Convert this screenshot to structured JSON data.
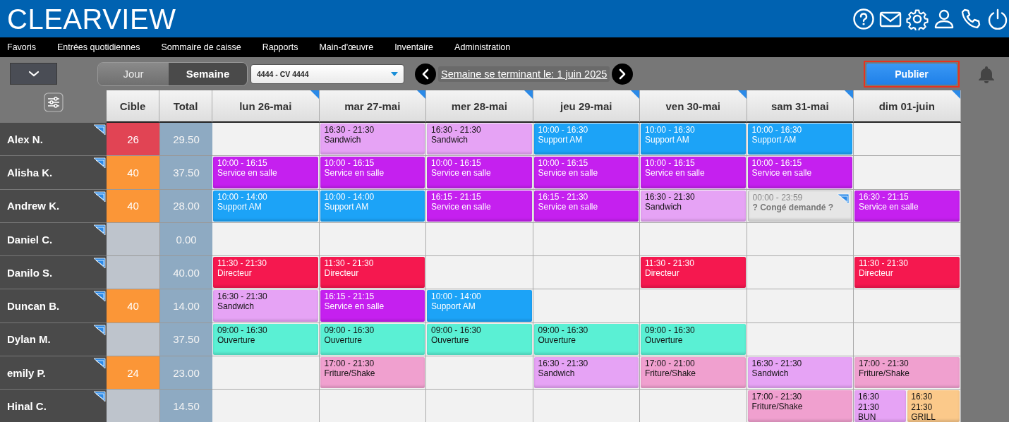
{
  "app": {
    "logo": "CLEARVIEW"
  },
  "menu": [
    "Favoris",
    "Entrées quotidiennes",
    "Sommaire de caisse",
    "Rapports",
    "Main-d'œuvre",
    "Inventaire",
    "Administration"
  ],
  "toolbar": {
    "views": [
      {
        "label": "Jour",
        "selected": false
      },
      {
        "label": "Semaine",
        "selected": true
      }
    ],
    "location_select": {
      "value": "4444 - CV 4444"
    },
    "week_label": "Semaine se terminant le: 1 juin 2025",
    "publish_button": {
      "label": "Publier",
      "highlighted": true
    }
  },
  "schedule": {
    "target_heading": "Cible",
    "total_heading": "Total",
    "days": [
      {
        "label": "lun 26-mai",
        "flagged": true
      },
      {
        "label": "mar 27-mai",
        "flagged": true
      },
      {
        "label": "mer 28-mai",
        "flagged": true
      },
      {
        "label": "jeu 29-mai",
        "flagged": true
      },
      {
        "label": "ven 30-mai",
        "flagged": true
      },
      {
        "label": "sam 31-mai",
        "flagged": true
      },
      {
        "label": "dim 01-juin",
        "flagged": true
      }
    ],
    "rows": [
      {
        "name": "Alex N.",
        "flagged": true,
        "target": {
          "value": "26",
          "color": "#e14454"
        },
        "total": "29.50",
        "cells": [
          {},
          {
            "shifts": [
              {
                "kind": "shift",
                "time": "16:30 - 21:30",
                "role": "Sandwich",
                "color": "#e6a3f5"
              }
            ]
          },
          {
            "shifts": [
              {
                "kind": "shift",
                "time": "16:30 - 21:30",
                "role": "Sandwich",
                "color": "#e6a3f5"
              }
            ]
          },
          {
            "shifts": [
              {
                "kind": "shift",
                "time": "10:00 - 16:30",
                "role": "Support AM",
                "color": "#1ca3f7"
              }
            ]
          },
          {
            "shifts": [
              {
                "kind": "shift",
                "time": "10:00 - 16:30",
                "role": "Support AM",
                "color": "#1ca3f7"
              }
            ]
          },
          {
            "shifts": [
              {
                "kind": "shift",
                "time": "10:00 - 16:30",
                "role": "Support AM",
                "color": "#1ca3f7"
              }
            ]
          },
          {}
        ]
      },
      {
        "name": "Alisha K.",
        "flagged": true,
        "target": {
          "value": "40",
          "color": "#fb9637"
        },
        "total": "37.50",
        "cells": [
          {
            "shifts": [
              {
                "kind": "shift",
                "time": "10:00 - 16:15",
                "role": "Service en salle",
                "color": "#c520ef"
              }
            ]
          },
          {
            "shifts": [
              {
                "kind": "shift",
                "time": "10:00 - 16:15",
                "role": "Service en salle",
                "color": "#c520ef"
              }
            ]
          },
          {
            "shifts": [
              {
                "kind": "shift",
                "time": "10:00 - 16:15",
                "role": "Service en salle",
                "color": "#c520ef"
              }
            ]
          },
          {
            "shifts": [
              {
                "kind": "shift",
                "time": "10:00 - 16:15",
                "role": "Service en salle",
                "color": "#c520ef"
              }
            ]
          },
          {
            "shifts": [
              {
                "kind": "shift",
                "time": "10:00 - 16:15",
                "role": "Service en salle",
                "color": "#c520ef"
              }
            ]
          },
          {
            "shifts": [
              {
                "kind": "shift",
                "time": "10:00 - 16:15",
                "role": "Service en salle",
                "color": "#c520ef"
              }
            ]
          },
          {}
        ]
      },
      {
        "name": "Andrew K.",
        "flagged": true,
        "target": {
          "value": "40",
          "color": "#fb9637"
        },
        "total": "28.00",
        "cells": [
          {
            "shifts": [
              {
                "kind": "shift",
                "time": "10:00 - 14:00",
                "role": "Support AM",
                "color": "#1ca3f7"
              }
            ]
          },
          {
            "shifts": [
              {
                "kind": "shift",
                "time": "10:00 - 14:00",
                "role": "Support AM",
                "color": "#1ca3f7"
              }
            ]
          },
          {
            "shifts": [
              {
                "kind": "shift",
                "time": "16:15 - 21:15",
                "role": "Service en salle",
                "color": "#c520ef"
              }
            ]
          },
          {
            "shifts": [
              {
                "kind": "shift",
                "time": "16:15 - 21:30",
                "role": "Service en salle",
                "color": "#c520ef"
              }
            ]
          },
          {
            "shifts": [
              {
                "kind": "shift",
                "time": "16:30 - 21:30",
                "role": "Sandwich",
                "color": "#e6a3f5"
              }
            ]
          },
          {
            "shifts": [
              {
                "kind": "leave",
                "time": "00:00 - 23:59",
                "role": "? Congé demandé ?",
                "color": "#e6e6e6",
                "flagged": true
              }
            ]
          },
          {
            "shifts": [
              {
                "kind": "shift",
                "time": "16:30 - 21:15",
                "role": "Service en salle",
                "color": "#c520ef"
              }
            ]
          }
        ]
      },
      {
        "name": "Daniel C.",
        "flagged": true,
        "total": "0.00",
        "cells": [
          {},
          {},
          {},
          {},
          {},
          {},
          {}
        ]
      },
      {
        "name": "Danilo S.",
        "flagged": true,
        "total": "40.00",
        "cells": [
          {
            "shifts": [
              {
                "kind": "shift",
                "time": "11:30 - 21:30",
                "role": "Directeur",
                "color": "#f5184f"
              }
            ]
          },
          {
            "shifts": [
              {
                "kind": "shift",
                "time": "11:30 - 21:30",
                "role": "Directeur",
                "color": "#f5184f"
              }
            ]
          },
          {},
          {},
          {
            "shifts": [
              {
                "kind": "shift",
                "time": "11:30 - 21:30",
                "role": "Directeur",
                "color": "#f5184f"
              }
            ]
          },
          {},
          {
            "shifts": [
              {
                "kind": "shift",
                "time": "11:30 - 21:30",
                "role": "Directeur",
                "color": "#f5184f"
              }
            ]
          }
        ]
      },
      {
        "name": "Duncan B.",
        "flagged": true,
        "target": {
          "value": "40",
          "color": "#fb9637"
        },
        "total": "14.00",
        "cells": [
          {
            "shifts": [
              {
                "kind": "shift",
                "time": "16:30 - 21:30",
                "role": "Sandwich",
                "color": "#e6a3f5"
              }
            ]
          },
          {
            "shifts": [
              {
                "kind": "shift",
                "time": "16:15 - 21:15",
                "role": "Service en salle",
                "color": "#c520ef"
              }
            ]
          },
          {
            "shifts": [
              {
                "kind": "shift",
                "time": "10:00 - 14:00",
                "role": "Support AM",
                "color": "#1ca3f7"
              }
            ]
          },
          {},
          {},
          {},
          {}
        ]
      },
      {
        "name": "Dylan M.",
        "flagged": true,
        "total": "37.50",
        "cells": [
          {
            "shifts": [
              {
                "kind": "shift",
                "time": "09:00 - 16:30",
                "role": "Ouverture",
                "color": "#5af0d4"
              }
            ]
          },
          {
            "shifts": [
              {
                "kind": "shift",
                "time": "09:00 - 16:30",
                "role": "Ouverture",
                "color": "#5af0d4"
              }
            ]
          },
          {
            "shifts": [
              {
                "kind": "shift",
                "time": "09:00 - 16:30",
                "role": "Ouverture",
                "color": "#5af0d4"
              }
            ]
          },
          {
            "shifts": [
              {
                "kind": "shift",
                "time": "09:00 - 16:30",
                "role": "Ouverture",
                "color": "#5af0d4"
              }
            ]
          },
          {
            "shifts": [
              {
                "kind": "shift",
                "time": "09:00 - 16:30",
                "role": "Ouverture",
                "color": "#5af0d4"
              }
            ]
          },
          {},
          {}
        ]
      },
      {
        "name": "emily P.",
        "flagged": true,
        "target": {
          "value": "24",
          "color": "#fb9637"
        },
        "total": "23.00",
        "cells": [
          {},
          {
            "shifts": [
              {
                "kind": "shift",
                "time": "17:00 - 21:30",
                "role": "Friture/Shake",
                "color": "#f0a0cf"
              }
            ]
          },
          {},
          {
            "shifts": [
              {
                "kind": "shift",
                "time": "16:30 - 21:30",
                "role": "Sandwich",
                "color": "#e6a3f5"
              }
            ]
          },
          {
            "shifts": [
              {
                "kind": "shift",
                "time": "17:00 - 21:00",
                "role": "Friture/Shake",
                "color": "#f0a0cf"
              }
            ]
          },
          {
            "shifts": [
              {
                "kind": "shift",
                "time": "16:30 - 21:30",
                "role": "Sandwich",
                "color": "#e6a3f5"
              }
            ]
          },
          {
            "shifts": [
              {
                "kind": "shift",
                "time": "17:00 - 21:30",
                "role": "Friture/Shake",
                "color": "#f0a0cf"
              }
            ]
          }
        ]
      },
      {
        "name": "Hinal C.",
        "flagged": true,
        "total": "14.50",
        "cells": [
          {},
          {},
          {},
          {},
          {},
          {
            "shifts": [
              {
                "kind": "shift",
                "time": "17:00 - 21:30",
                "role": "Friture/Shake",
                "color": "#f0a0cf"
              }
            ]
          },
          {
            "shifts": [
              {
                "kind": "compact",
                "start": "16:30",
                "end": "21:30",
                "role": "BUN",
                "color": "#e6a3f5"
              },
              {
                "kind": "compact",
                "start": "16:30",
                "end": "21:30",
                "role": "GRILL",
                "color": "#fbc98a"
              }
            ]
          }
        ]
      }
    ]
  }
}
